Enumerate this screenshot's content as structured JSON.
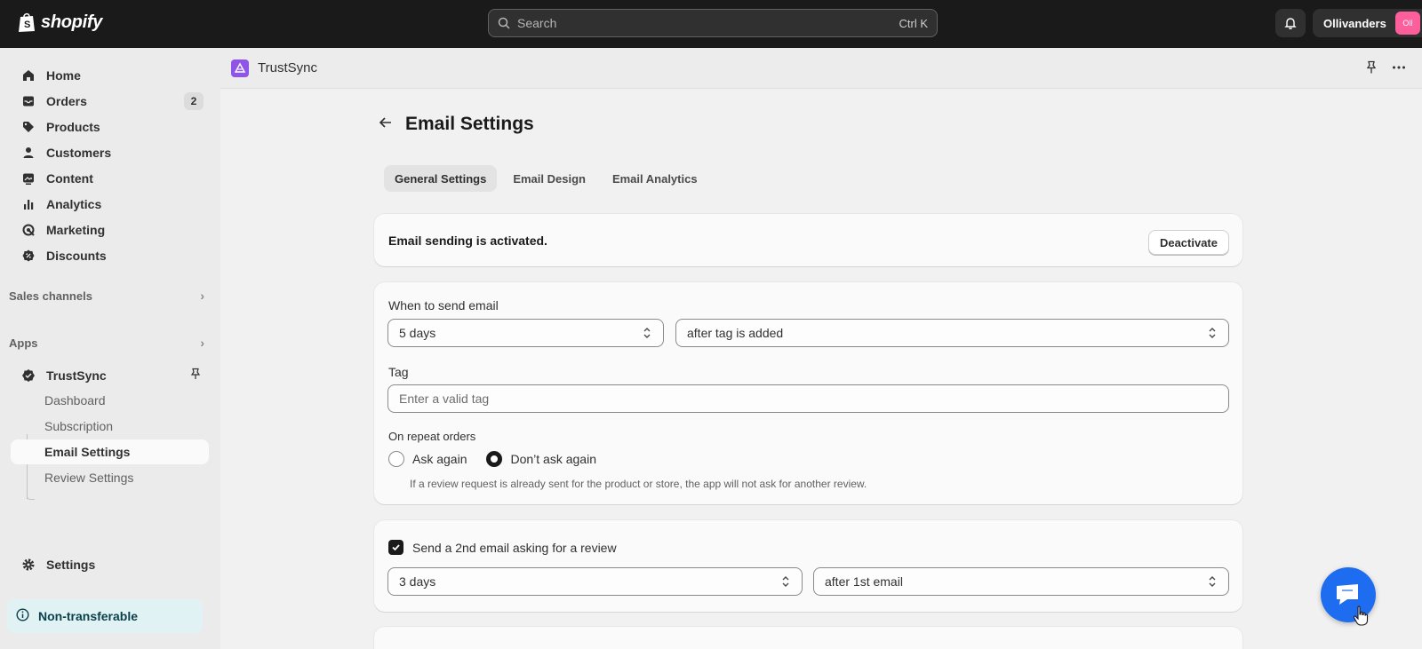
{
  "topbar": {
    "brand": "shopify",
    "search_placeholder": "Search",
    "search_shortcut": "Ctrl K",
    "store_name": "Ollivanders",
    "store_initials": "Oll"
  },
  "sidebar": {
    "items": [
      {
        "label": "Home",
        "icon": "home-icon"
      },
      {
        "label": "Orders",
        "icon": "inbox-icon",
        "count": "2"
      },
      {
        "label": "Products",
        "icon": "tag-icon"
      },
      {
        "label": "Customers",
        "icon": "person-icon"
      },
      {
        "label": "Content",
        "icon": "image-icon"
      },
      {
        "label": "Analytics",
        "icon": "bar-chart-icon"
      },
      {
        "label": "Marketing",
        "icon": "target-icon"
      },
      {
        "label": "Discounts",
        "icon": "discount-icon"
      }
    ],
    "sales_channels": "Sales channels",
    "apps": "Apps",
    "app_name": "TrustSync",
    "app_subitems": [
      "Dashboard",
      "Subscription",
      "Email Settings",
      "Review Settings"
    ],
    "settings": "Settings",
    "notice": "Non-transferable"
  },
  "app_header": {
    "name": "TrustSync"
  },
  "page": {
    "title": "Email Settings",
    "tabs": [
      "General Settings",
      "Email Design",
      "Email Analytics"
    ],
    "active_tab": "General Settings"
  },
  "status_card": {
    "message": "Email sending is activated.",
    "button": "Deactivate"
  },
  "timing_card": {
    "when_label": "When to send email",
    "delay_value": "5 days",
    "trigger_value": "after tag is added",
    "tag_label": "Tag",
    "tag_placeholder": "Enter a valid tag",
    "repeat_label": "On repeat orders",
    "option_ask": "Ask again",
    "option_dont_ask": "Don’t ask again",
    "selected_option": "Don’t ask again",
    "help_text": "If a review request is already sent for the product or store, the app will not ask for another review."
  },
  "second_email_card": {
    "checkbox_label": "Send a 2nd email asking for a review",
    "checked": true,
    "delay_value": "3 days",
    "trigger_value": "after 1st email"
  },
  "colors": {
    "topbar": "#1a1a1a",
    "chat_button": "#1e6cf0",
    "app_logo": "#8f55e8",
    "avatar": "#ff5e9c"
  }
}
